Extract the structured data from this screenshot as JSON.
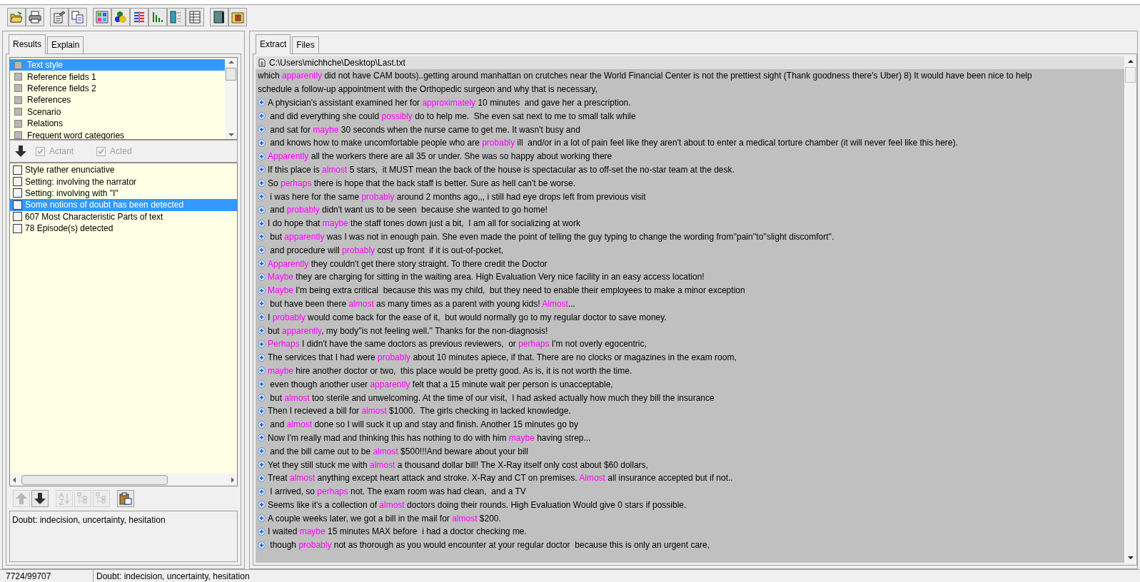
{
  "toolbar": {
    "buttons": [
      {
        "kind": "open"
      },
      {
        "kind": "print"
      },
      {
        "kind": "properties"
      },
      {
        "kind": "copy"
      },
      {
        "kind": "grid"
      },
      {
        "kind": "spheres"
      },
      {
        "kind": "columns"
      },
      {
        "kind": "bars"
      },
      {
        "kind": "tree"
      },
      {
        "kind": "table"
      },
      {
        "kind": "book"
      },
      {
        "kind": "package"
      }
    ]
  },
  "left_panel": {
    "tabs": [
      {
        "label": "Results",
        "selected": true
      },
      {
        "label": "Explain",
        "selected": false
      }
    ],
    "categories": [
      {
        "label": "Text style",
        "selected": true
      },
      {
        "label": "Reference fields 1",
        "selected": false
      },
      {
        "label": "Reference fields 2",
        "selected": false
      },
      {
        "label": "References",
        "selected": false
      },
      {
        "label": "Scenario",
        "selected": false
      },
      {
        "label": "Relations",
        "selected": false
      },
      {
        "label": "Frequent word categories",
        "selected": false
      }
    ],
    "filters": [
      {
        "label": "Actant",
        "checked": true,
        "disabled": true
      },
      {
        "label": "Acted",
        "checked": true,
        "disabled": true
      }
    ],
    "results": [
      {
        "label": "Style rather enunciative",
        "checked": false,
        "selected": false
      },
      {
        "label": "Setting: involving the narrator",
        "checked": false,
        "selected": false
      },
      {
        "label": "Setting: involving with \"I\"",
        "checked": false,
        "selected": false
      },
      {
        "label": "Some notions of doubt has been detected",
        "checked": false,
        "selected": true
      },
      {
        "label": "607 Most Characteristic Parts of text",
        "checked": false,
        "selected": false
      },
      {
        "label": "78 Episode(s) detected",
        "checked": false,
        "selected": false
      }
    ],
    "tools": [
      {
        "kind": "up",
        "disabled": true
      },
      {
        "kind": "down",
        "disabled": false
      },
      {
        "kind": "sort",
        "disabled": true
      },
      {
        "kind": "expand",
        "disabled": true
      },
      {
        "kind": "collapse",
        "disabled": true
      },
      {
        "kind": "clipboard",
        "disabled": false
      }
    ],
    "description": "Doubt: indecision, uncertainty, hesitation"
  },
  "right_panel": {
    "tabs": [
      {
        "label": "Extract",
        "selected": true
      },
      {
        "label": "Files",
        "selected": false
      }
    ],
    "file_path": "C:\\Users\\michhche\\Desktop\\Last.txt",
    "lines": [
      {
        "bullet": false,
        "parts": [
          {
            "text": "which ",
            "highlighted": false
          },
          {
            "text": "apparently",
            "highlighted": true
          },
          {
            "text": " did not have CAM boots)..getting around manhattan on crutches near the World Financial Center is not the prettiest sight (Thank goodness there's Uber) 8) It would have been nice to help",
            "highlighted": false
          }
        ]
      },
      {
        "bullet": false,
        "parts": [
          {
            "text": "schedule a follow-up appointment with the Orthopedic surgeon and why that is necessary,",
            "highlighted": false
          }
        ]
      },
      {
        "bullet": true,
        "parts": [
          {
            "text": "A physician's assistant examined her for ",
            "highlighted": false
          },
          {
            "text": "approximately",
            "highlighted": true
          },
          {
            "text": " 10 minutes  and gave her a prescription.",
            "highlighted": false
          }
        ]
      },
      {
        "bullet": true,
        "parts": [
          {
            "text": " and did everything she could ",
            "highlighted": false
          },
          {
            "text": "possibly",
            "highlighted": true
          },
          {
            "text": " do to help me.  She even sat next to me to small talk while",
            "highlighted": false
          }
        ]
      },
      {
        "bullet": true,
        "parts": [
          {
            "text": " and sat for ",
            "highlighted": false
          },
          {
            "text": "maybe",
            "highlighted": true
          },
          {
            "text": " 30 seconds when the nurse came to get me. It wasn't busy and",
            "highlighted": false
          }
        ]
      },
      {
        "bullet": true,
        "parts": [
          {
            "text": " and knows how to make uncomfortable people who are ",
            "highlighted": false
          },
          {
            "text": "probably",
            "highlighted": true
          },
          {
            "text": " ill  and/or in a lot of pain feel like they aren't about to enter a medical torture chamber (it will never feel like this here).",
            "highlighted": false
          }
        ]
      },
      {
        "bullet": true,
        "parts": [
          {
            "text": "Apparently",
            "highlighted": true
          },
          {
            "text": " all the workers there are all 35 or under. She was so happy about working there",
            "highlighted": false
          }
        ]
      },
      {
        "bullet": true,
        "parts": [
          {
            "text": "If this place is ",
            "highlighted": false
          },
          {
            "text": "almost",
            "highlighted": true
          },
          {
            "text": " 5 stars,  it MUST mean the back of the house is spectacular as to off-set the no-star team at the desk.",
            "highlighted": false
          }
        ]
      },
      {
        "bullet": true,
        "parts": [
          {
            "text": "So ",
            "highlighted": false
          },
          {
            "text": "perhaps",
            "highlighted": true
          },
          {
            "text": " there is hope that the back staff is better. Sure as hell can't be worse.",
            "highlighted": false
          }
        ]
      },
      {
        "bullet": true,
        "parts": [
          {
            "text": " i was here for the same ",
            "highlighted": false
          },
          {
            "text": "probably",
            "highlighted": true
          },
          {
            "text": " around 2 months ago,,, i still had eye drops left from previous visit",
            "highlighted": false
          }
        ]
      },
      {
        "bullet": true,
        "parts": [
          {
            "text": " and ",
            "highlighted": false
          },
          {
            "text": "probably",
            "highlighted": true
          },
          {
            "text": " didn't want us to be seen  because she wanted to go home!",
            "highlighted": false
          }
        ]
      },
      {
        "bullet": true,
        "parts": [
          {
            "text": "I do hope that ",
            "highlighted": false
          },
          {
            "text": "maybe",
            "highlighted": true
          },
          {
            "text": " the staff tones down just a bit,  I am all for socializing at work",
            "highlighted": false
          }
        ]
      },
      {
        "bullet": true,
        "parts": [
          {
            "text": " but ",
            "highlighted": false
          },
          {
            "text": "apparently",
            "highlighted": true
          },
          {
            "text": " was I was not in enough pain. She even made the point of telling the guy typing to change the wording from''pain''to''slight discomfort''.",
            "highlighted": false
          }
        ]
      },
      {
        "bullet": true,
        "parts": [
          {
            "text": " and procedure will ",
            "highlighted": false
          },
          {
            "text": "probably",
            "highlighted": true
          },
          {
            "text": " cost up front  if it is out-of-pocket,",
            "highlighted": false
          }
        ]
      },
      {
        "bullet": true,
        "parts": [
          {
            "text": "Apparently",
            "highlighted": true
          },
          {
            "text": " they couldn't get there story straight. To there credit the Doctor",
            "highlighted": false
          }
        ]
      },
      {
        "bullet": true,
        "parts": [
          {
            "text": "Maybe",
            "highlighted": true
          },
          {
            "text": " they are charging for sitting in the waiting area. High Evaluation Very nice facility in an easy access location!",
            "highlighted": false
          }
        ]
      },
      {
        "bullet": true,
        "parts": [
          {
            "text": "Maybe",
            "highlighted": true
          },
          {
            "text": " I'm being extra critical  because this was my child,  but they need to enable their employees to make a minor exception",
            "highlighted": false
          }
        ]
      },
      {
        "bullet": true,
        "parts": [
          {
            "text": " but have been there ",
            "highlighted": false
          },
          {
            "text": "almost",
            "highlighted": true
          },
          {
            "text": " as many times as a parent with young kids! ",
            "highlighted": false
          },
          {
            "text": "Almost",
            "highlighted": true
          },
          {
            "text": "...",
            "highlighted": false
          }
        ]
      },
      {
        "bullet": true,
        "parts": [
          {
            "text": "I ",
            "highlighted": false
          },
          {
            "text": "probably",
            "highlighted": true
          },
          {
            "text": " would come back for the ease of it,  but would normally go to my regular doctor to save money.",
            "highlighted": false
          }
        ]
      },
      {
        "bullet": true,
        "parts": [
          {
            "text": "but ",
            "highlighted": false
          },
          {
            "text": "apparently",
            "highlighted": true
          },
          {
            "text": ", my body''is not feeling well.'' Thanks for the non-diagnosis!",
            "highlighted": false
          }
        ]
      },
      {
        "bullet": true,
        "parts": [
          {
            "text": "Perhaps",
            "highlighted": true
          },
          {
            "text": " I didn't have the same doctors as previous reviewers,  or ",
            "highlighted": false
          },
          {
            "text": "perhaps",
            "highlighted": true
          },
          {
            "text": " I'm not overly egocentric,",
            "highlighted": false
          }
        ]
      },
      {
        "bullet": true,
        "parts": [
          {
            "text": "The services that I had were ",
            "highlighted": false
          },
          {
            "text": "probably",
            "highlighted": true
          },
          {
            "text": " about 10 minutes apiece, if that. There are no clocks or magazines in the exam room,",
            "highlighted": false
          }
        ]
      },
      {
        "bullet": true,
        "parts": [
          {
            "text": "maybe",
            "highlighted": true
          },
          {
            "text": " hire another doctor or two,  this place would be pretty good. As is, it is not worth the time.",
            "highlighted": false
          }
        ]
      },
      {
        "bullet": true,
        "parts": [
          {
            "text": " even though another user ",
            "highlighted": false
          },
          {
            "text": "apparently",
            "highlighted": true
          },
          {
            "text": " felt that a 15 minute wait per person is unacceptable,",
            "highlighted": false
          }
        ]
      },
      {
        "bullet": true,
        "parts": [
          {
            "text": " but ",
            "highlighted": false
          },
          {
            "text": "almost",
            "highlighted": true
          },
          {
            "text": " too sterile and unwelcoming. At the time of our visit,  I had asked actually how much they bill the insurance",
            "highlighted": false
          }
        ]
      },
      {
        "bullet": true,
        "parts": [
          {
            "text": "Then I recieved a bill for ",
            "highlighted": false
          },
          {
            "text": "almost",
            "highlighted": true
          },
          {
            "text": " $1000.  The girls checking in lacked knowledge.",
            "highlighted": false
          }
        ]
      },
      {
        "bullet": true,
        "parts": [
          {
            "text": " and ",
            "highlighted": false
          },
          {
            "text": "almost",
            "highlighted": true
          },
          {
            "text": " done so I will suck it up and stay and finish. Another 15 minutes go by",
            "highlighted": false
          }
        ]
      },
      {
        "bullet": true,
        "parts": [
          {
            "text": "Now I'm really mad and thinking this has nothing to do with him ",
            "highlighted": false
          },
          {
            "text": "maybe",
            "highlighted": true
          },
          {
            "text": " having strep...",
            "highlighted": false
          }
        ]
      },
      {
        "bullet": true,
        "parts": [
          {
            "text": " and the bill came out to be ",
            "highlighted": false
          },
          {
            "text": "almost",
            "highlighted": true
          },
          {
            "text": " $500!!!And beware about your bill",
            "highlighted": false
          }
        ]
      },
      {
        "bullet": true,
        "parts": [
          {
            "text": "Yet they still stuck me with ",
            "highlighted": false
          },
          {
            "text": "almost",
            "highlighted": true
          },
          {
            "text": " a thousand dollar bill! The X-Ray itself only cost about $60 dollars,",
            "highlighted": false
          }
        ]
      },
      {
        "bullet": true,
        "parts": [
          {
            "text": "Treat ",
            "highlighted": false
          },
          {
            "text": "almost",
            "highlighted": true
          },
          {
            "text": " anything except heart attack and stroke. X-Ray and CT on premises. ",
            "highlighted": false
          },
          {
            "text": "Almost",
            "highlighted": true
          },
          {
            "text": " all insurance accepted but if not..",
            "highlighted": false
          }
        ]
      },
      {
        "bullet": true,
        "parts": [
          {
            "text": " I arrived, so ",
            "highlighted": false
          },
          {
            "text": "perhaps",
            "highlighted": true
          },
          {
            "text": " not. The exam room was had clean,  and a TV",
            "highlighted": false
          }
        ]
      },
      {
        "bullet": true,
        "parts": [
          {
            "text": "Seems like it's a collection of ",
            "highlighted": false
          },
          {
            "text": "almost",
            "highlighted": true
          },
          {
            "text": " doctors doing their rounds. High Evaluation Would give 0 stars if possible.",
            "highlighted": false
          }
        ]
      },
      {
        "bullet": true,
        "parts": [
          {
            "text": "A couple weeks later, we got a bill in the mail for ",
            "highlighted": false
          },
          {
            "text": "almost",
            "highlighted": true
          },
          {
            "text": " $200.",
            "highlighted": false
          }
        ]
      },
      {
        "bullet": true,
        "parts": [
          {
            "text": "I waited ",
            "highlighted": false
          },
          {
            "text": "maybe",
            "highlighted": true
          },
          {
            "text": " 15 minutes MAX before  i had a doctor checking me.",
            "highlighted": false
          }
        ]
      },
      {
        "bullet": true,
        "parts": [
          {
            "text": " though ",
            "highlighted": false
          },
          {
            "text": "probably",
            "highlighted": true
          },
          {
            "text": " not as thorough as you would encounter at your regular doctor  because this is only an urgent care,",
            "highlighted": false
          }
        ]
      }
    ]
  },
  "status_bar": {
    "position": "7724/99707",
    "message": "Doubt: indecision, uncertainty, hesitation"
  }
}
